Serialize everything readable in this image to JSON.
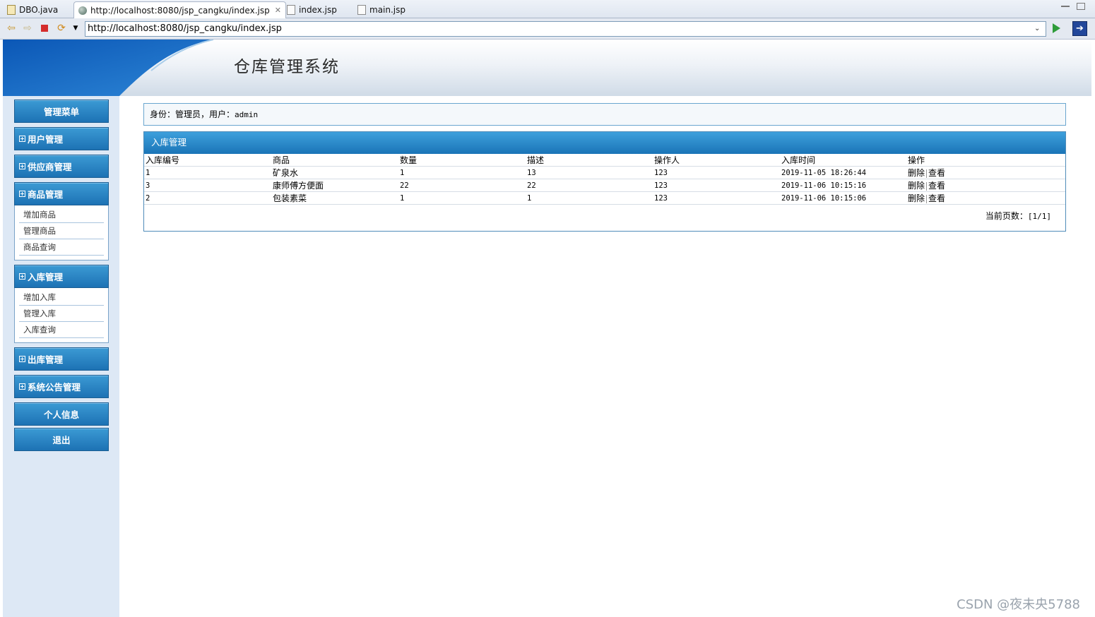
{
  "ide_tabs": [
    {
      "label": "DBO.java",
      "icon": "java-file-icon",
      "active": false
    },
    {
      "label": "http://localhost:8080/jsp_cangku/index.jsp",
      "icon": "globe-icon",
      "active": true
    },
    {
      "label": "index.jsp",
      "icon": "jsp-file-icon",
      "active": false
    },
    {
      "label": "main.jsp",
      "icon": "jsp-file-icon",
      "active": false
    }
  ],
  "address_bar": {
    "url": "http://localhost:8080/jsp_cangku/index.jsp"
  },
  "header": {
    "title": "仓库管理系统"
  },
  "sidebar": {
    "menu_title": "管理菜单",
    "groups": [
      {
        "label": "用户管理",
        "items": []
      },
      {
        "label": "供应商管理",
        "items": []
      },
      {
        "label": "商品管理",
        "items": [
          "增加商品",
          "管理商品",
          "商品查询"
        ]
      },
      {
        "label": "入库管理",
        "items": [
          "增加入库",
          "管理入库",
          "入库查询"
        ]
      },
      {
        "label": "出库管理",
        "items": []
      },
      {
        "label": "系统公告管理",
        "items": []
      }
    ],
    "personal_info": "个人信息",
    "logout": "退出"
  },
  "identity": {
    "prefix": "身份：管理员，用户：",
    "username": "admin"
  },
  "panel": {
    "title": "入库管理",
    "columns": [
      "入库编号",
      "商品",
      "数量",
      "描述",
      "操作人",
      "入库时间",
      "操作"
    ],
    "rows": [
      {
        "id": "1",
        "product": "矿泉水",
        "qty": "1",
        "desc": "13",
        "operator": "123",
        "time": "2019-11-05 18:26:44"
      },
      {
        "id": "3",
        "product": "康师傅方便面",
        "qty": "22",
        "desc": "22",
        "operator": "123",
        "time": "2019-11-06 10:15:16"
      },
      {
        "id": "2",
        "product": "包装素菜",
        "qty": "1",
        "desc": "1",
        "operator": "123",
        "time": "2019-11-06 10:15:06"
      }
    ],
    "actions": {
      "delete": "删除",
      "view": "查看"
    },
    "pager_label": "当前页数：",
    "pager_value": "[1/1]"
  },
  "watermark": "CSDN @夜未央5788",
  "colors": {
    "accent_blue": "#1d72b4",
    "sidebar_bg": "#dde8f5"
  }
}
